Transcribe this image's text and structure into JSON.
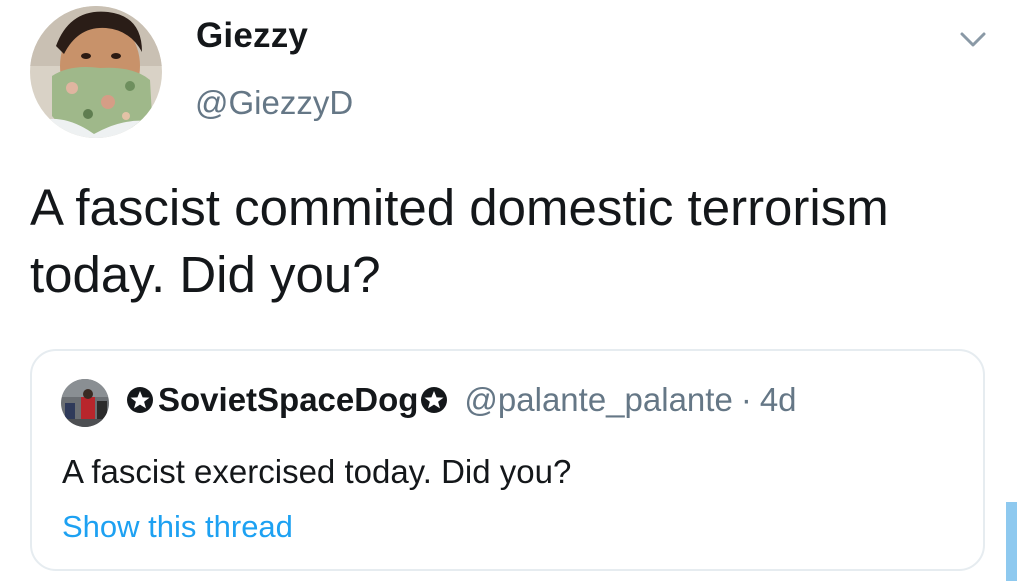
{
  "tweet": {
    "author": {
      "display_name": "Giezzy",
      "handle": "@GiezzyD"
    },
    "text": "A fascist commited domestic terrorism today. Did you?",
    "menu_icon": "chevron-down-icon"
  },
  "quoted_tweet": {
    "author": {
      "display_name": "SovietSpaceDog",
      "handle": "@palante_palante",
      "name_decoration_icon": "star-badge-icon"
    },
    "separator": "·",
    "timestamp": "4d",
    "text": "A fascist exercised today. Did you?",
    "show_thread_label": "Show this thread"
  },
  "colors": {
    "text": "#14171a",
    "secondary": "#657786",
    "link": "#1da1f2",
    "border": "#e6ecf0"
  }
}
